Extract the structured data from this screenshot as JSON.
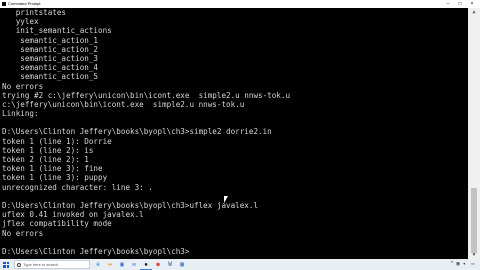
{
  "window": {
    "title": "Command Prompt"
  },
  "console": {
    "lines": [
      "   printstates",
      "   yylex",
      "   init_semantic_actions",
      "    semantic_action_1",
      "    semantic_action_2",
      "    semantic_action_3",
      "    semantic_action_4",
      "    semantic_action_5",
      "No errors",
      "trying #2 c:\\jeffery\\unicon\\bin\\icont.exe  simple2.u nnws-tok.u",
      "c:\\jeffery\\unicon\\bin\\icont.exe  simple2.u nnws-tok.u",
      "Linking:",
      "",
      "D:\\Users\\Clinton Jeffery\\books\\byopl\\ch3>simple2 dorrie2.in",
      "token 1 (line 1): Dorrie",
      "token 1 (line 2): is",
      "token 2 (line 2): 1",
      "token 1 (line 3): fine",
      "token 1 (line 3): puppy",
      "unrecognized character: line 3: .",
      "",
      "D:\\Users\\Clinton Jeffery\\books\\byopl\\ch3>uflex javalex.l",
      "uflex 0.41 invoked on javalex.l",
      "jflex compatibility mode",
      "No errors",
      "",
      "D:\\Users\\Clinton Jeffery\\books\\byopl\\ch3>"
    ]
  },
  "taskbar": {
    "search_placeholder": "Type here to search",
    "apps": [
      "edge-icon",
      "folder-icon",
      "store-icon",
      "mail-icon",
      "terminal-icon",
      "chrome-icon",
      "word-icon",
      "calendar-icon"
    ],
    "clock_time": "",
    "clock_date": ""
  },
  "colors": {
    "console_bg": "#000000",
    "console_text": "#d6d6d6",
    "taskbar_bg": "#e9eef5"
  }
}
